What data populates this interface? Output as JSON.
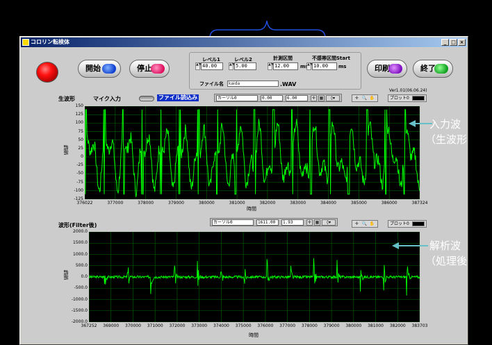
{
  "window": {
    "title": "コロリン転検体"
  },
  "buttons": {
    "start_label": "開始",
    "stop_label": "停止",
    "print_label": "印刷",
    "exit_label": "終了"
  },
  "settings": {
    "level1": {
      "label": "レベル1",
      "value": "40.00"
    },
    "level2": {
      "label": "レベル2",
      "value": "5.00"
    },
    "measure": {
      "label": "計測区間",
      "value": "12.00",
      "unit": "ms"
    },
    "deadband": {
      "label": "不感帯区間Start",
      "value": "10.00",
      "unit": "ms"
    },
    "filename": {
      "label": "ファイル名",
      "value": "kaida",
      "ext": ".WAV"
    }
  },
  "raw_graph": {
    "title": "生波形",
    "mic_label": "マイク入力",
    "file_label": "ファイル読込み",
    "cursor": {
      "name": "カーソル0",
      "x": "0.00",
      "y": "6.00"
    },
    "version": "Ver1.01(06.06.24)",
    "plot_label": "プロット0",
    "ylabel": "振幅",
    "xlabel": "時間",
    "yticks": [
      "150",
      "125",
      "100",
      "75",
      "50",
      "25",
      "0",
      "-25",
      "-50",
      "-75",
      "-100",
      "-125"
    ],
    "xticks": [
      "376022",
      "377000",
      "378000",
      "379000",
      "380000",
      "381000",
      "382000",
      "383000",
      "384000",
      "385000",
      "386000",
      "387324"
    ]
  },
  "filter_graph": {
    "title": "波形(Filter後)",
    "cursor": {
      "name": "カーソル0",
      "x": "1611.00",
      "y": "1.93"
    },
    "plot_label": "プロット0",
    "ylabel": "振幅",
    "xlabel": "時間",
    "yticks": [
      "2000.0",
      "1500.0",
      "1000.0",
      "500.0",
      "0.0",
      "-500.0",
      "-1000.0",
      "-1500.0",
      "-2000.0"
    ],
    "xticks": [
      "367252",
      "369000",
      "370000",
      "371000",
      "372000",
      "373000",
      "374000",
      "375000",
      "376000",
      "377000",
      "378000",
      "379000",
      "380000",
      "381000",
      "382000",
      "383703"
    ]
  },
  "annotations": {
    "raw_line1": "入力波",
    "raw_line2": "（生波形",
    "filter_line1": "解析波",
    "filter_line2": "（処理後"
  },
  "colors": {
    "trace": "#00ff00",
    "grid": "#006600",
    "annotation_arrow": "#66c0c8",
    "titlebar": "#0a246a"
  },
  "chart_data": [
    {
      "type": "line",
      "title": "生波形",
      "xlabel": "時間",
      "ylabel": "振幅",
      "xlim": [
        376022,
        387324
      ],
      "ylim": [
        -125,
        150
      ],
      "grid": true,
      "series": [
        {
          "values_described": "green raw waveform oscillating roughly between -125 and 150 with repeated bursts"
        }
      ]
    },
    {
      "type": "line",
      "title": "波形(Filter後)",
      "xlabel": "時間",
      "ylabel": "振幅",
      "xlim": [
        367252,
        383703
      ],
      "ylim": [
        -2000,
        2000
      ],
      "grid": true,
      "series": [
        {
          "values_described": "filtered waveform near 0 with periodic spikes about ±1000"
        }
      ]
    }
  ]
}
